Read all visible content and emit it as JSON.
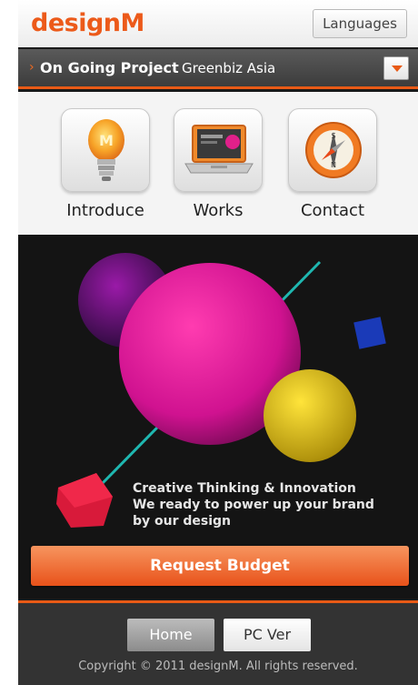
{
  "header": {
    "logo": "designM",
    "languages_label": "Languages"
  },
  "project_bar": {
    "label": "On Going Project",
    "value": "Greenbiz Asia"
  },
  "nav": [
    {
      "label": "Introduce",
      "icon": "lightbulb-icon"
    },
    {
      "label": "Works",
      "icon": "laptop-icon"
    },
    {
      "label": "Contact",
      "icon": "compass-icon"
    }
  ],
  "hero": {
    "line1": "Creative Thinking & Innovation",
    "line2": "We ready to power up your brand",
    "line3": "by our design",
    "cta_label": "Request Budget"
  },
  "footer": {
    "home_label": "Home",
    "pc_label": "PC Ver",
    "copyright": "Copyright © 2011 designM. All rights reserved."
  },
  "colors": {
    "accent": "#e85a16",
    "logo": "#ec5a1a",
    "bar": "#3c3c3c"
  }
}
